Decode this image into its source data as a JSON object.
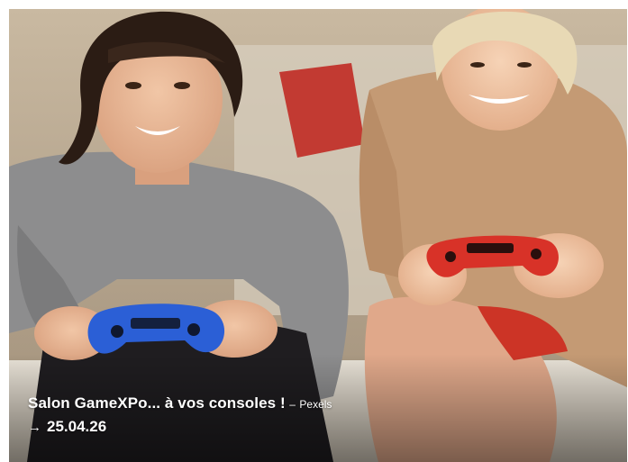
{
  "image": {
    "alt_scene": "two-people-playing-video-games-with-controllers-on-couch"
  },
  "caption": {
    "title": "Salon GameXPo... à vos consoles !",
    "separator": "–",
    "credit": "Pexels",
    "date_arrow_icon": "arrow-right-icon",
    "date": "25.04.26"
  },
  "colors": {
    "caption_text": "#ffffff",
    "controller_left": "#2b5fd6",
    "controller_right": "#d83228",
    "cushion_red": "#c23a32"
  }
}
